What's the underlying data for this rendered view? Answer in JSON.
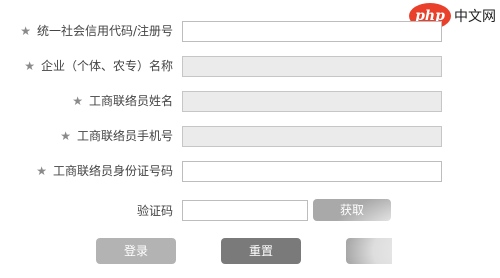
{
  "watermark": {
    "logo_text": "php",
    "site_text": "中文网"
  },
  "form": {
    "fields": [
      {
        "label": "统一社会信用代码/注册号",
        "required": true,
        "value": ""
      },
      {
        "label": "企业（个体、农专）名称",
        "required": true,
        "value": ""
      },
      {
        "label": "工商联络员姓名",
        "required": true,
        "value": ""
      },
      {
        "label": "工商联络员手机号",
        "required": true,
        "value": ""
      },
      {
        "label": "工商联络员身份证号码",
        "required": true,
        "value": ""
      }
    ],
    "required_marker": "★",
    "captcha": {
      "label": "验证码",
      "value": "",
      "button_label": "获取"
    }
  },
  "actions": {
    "login_label": "登录",
    "reset_label": "重置",
    "extra_label": ""
  }
}
